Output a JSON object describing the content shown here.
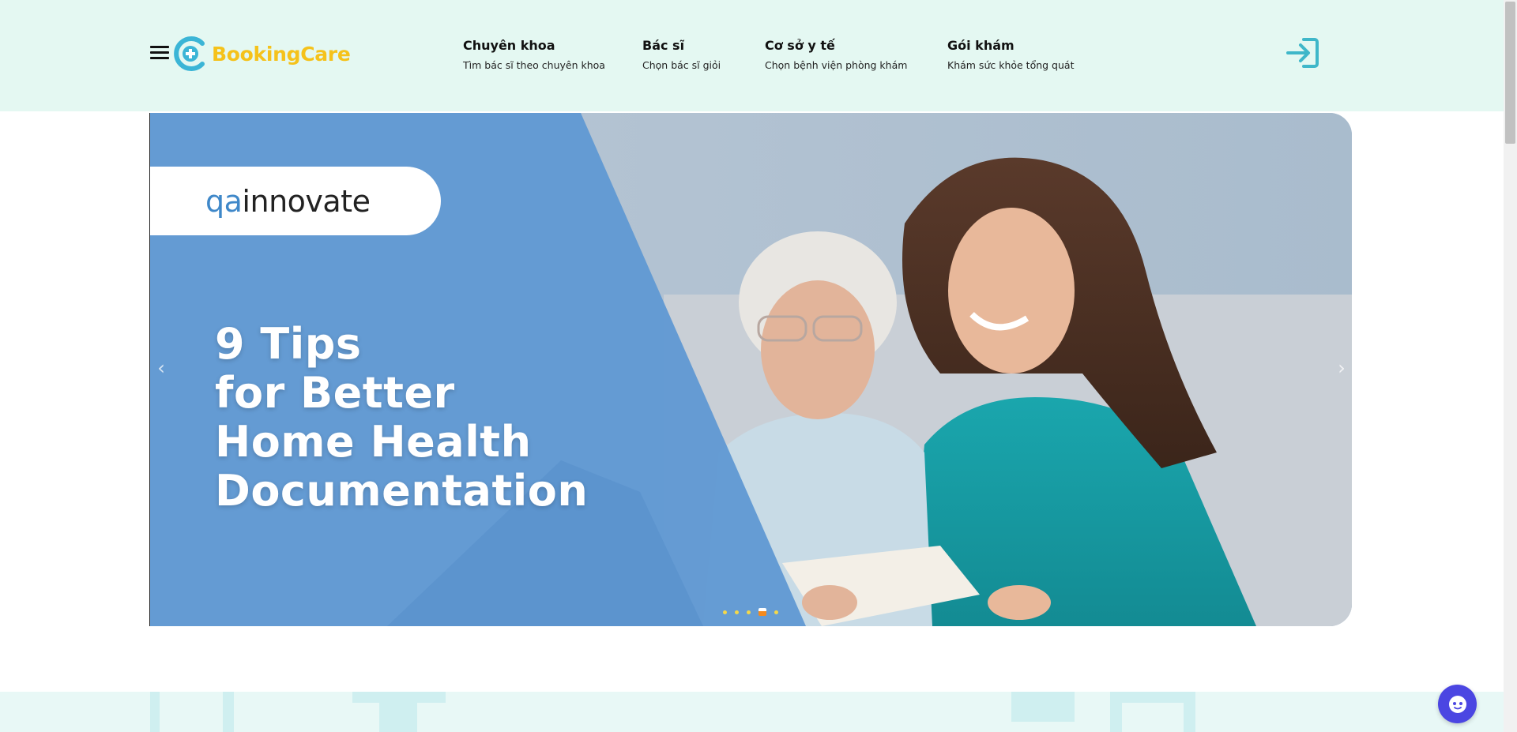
{
  "brand": {
    "name": "BookingCare"
  },
  "nav": {
    "items": [
      {
        "title": "Chuyên khoa",
        "subtitle": "Tìm bác sĩ theo chuyên khoa"
      },
      {
        "title": "Bác sĩ",
        "subtitle": "Chọn bác sĩ giỏi"
      },
      {
        "title": "Cơ sở y tế",
        "subtitle": "Chọn bệnh viện phòng khám"
      },
      {
        "title": "Gói khám",
        "subtitle": "Khám sức khỏe tổng quát"
      }
    ]
  },
  "banner": {
    "brand_prefix": "qa",
    "brand_suffix": "innovate",
    "headline": [
      "9 Tips",
      "for Better",
      "Home Health",
      "Documentation"
    ],
    "slide_count": 5,
    "active_slide": 4
  },
  "icons": {
    "menu": "menu-icon",
    "login": "login-icon",
    "prev": "chevron-left-icon",
    "next": "chevron-right-icon",
    "chat": "chatbot-icon"
  },
  "colors": {
    "header_bg": "#e4f8f2",
    "brand_yellow": "#f5c21b",
    "brand_blue": "#3bb5d6",
    "login_teal": "#3fb7c9",
    "chat_purple": "#4b46e2"
  }
}
